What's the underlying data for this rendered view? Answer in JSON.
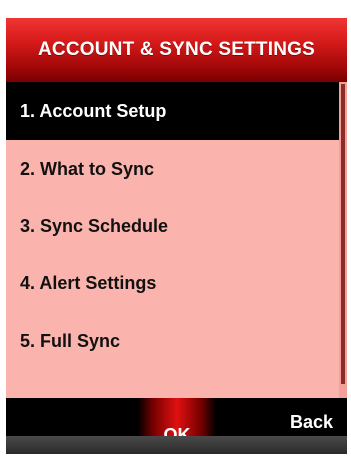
{
  "header": {
    "title": "ACCOUNT & SYNC SETTINGS"
  },
  "menu": {
    "items": [
      {
        "label": "1. Account Setup",
        "selected": true
      },
      {
        "label": "2. What to Sync",
        "selected": false
      },
      {
        "label": "3. Sync Schedule",
        "selected": false
      },
      {
        "label": "4. Alert Settings",
        "selected": false
      },
      {
        "label": "5. Full Sync",
        "selected": false
      }
    ]
  },
  "softkeys": {
    "ok_label": "OK",
    "back_label": "Back"
  },
  "colors": {
    "title_bar": "#d81b1b",
    "menu_background": "#fbb4ad",
    "selected_row": "#000000",
    "softkey_bar": "#000000",
    "ok_highlight": "#e01010"
  }
}
